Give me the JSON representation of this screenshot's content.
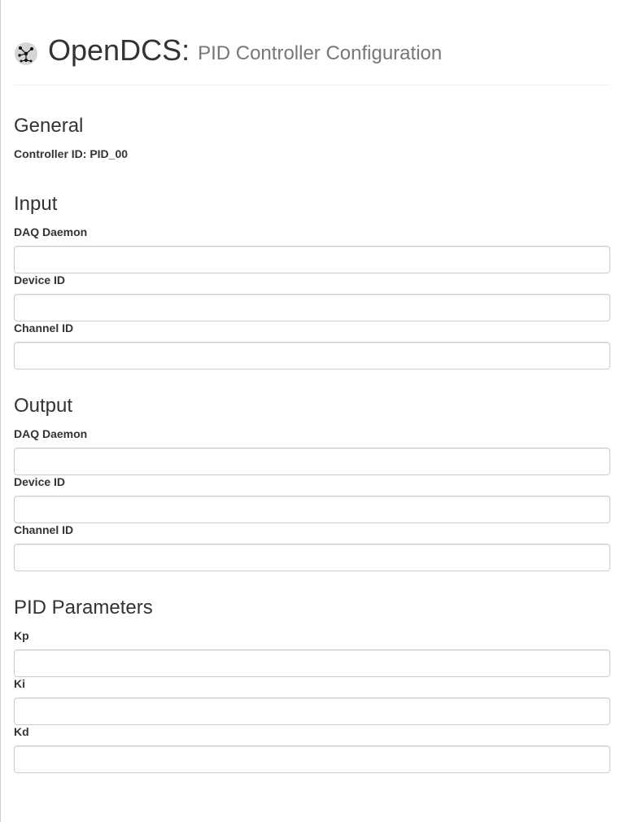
{
  "header": {
    "title": "OpenDCS:",
    "subtitle": "PID Controller Configuration",
    "logo_icon": "network-node-icon"
  },
  "general": {
    "heading": "General",
    "controller_id_text": "Controller ID: PID_00"
  },
  "input": {
    "heading": "Input",
    "daq_daemon_label": "DAQ Daemon",
    "daq_daemon_value": "",
    "device_id_label": "Device ID",
    "device_id_value": "",
    "channel_id_label": "Channel ID",
    "channel_id_value": ""
  },
  "output": {
    "heading": "Output",
    "daq_daemon_label": "DAQ Daemon",
    "daq_daemon_value": "",
    "device_id_label": "Device ID",
    "device_id_value": "",
    "channel_id_label": "Channel ID",
    "channel_id_value": ""
  },
  "pid": {
    "heading": "PID Parameters",
    "kp_label": "Kp",
    "kp_value": "",
    "ki_label": "Ki",
    "ki_value": "",
    "kd_label": "Kd",
    "kd_value": ""
  },
  "colors": {
    "text": "#333333",
    "subtitle": "#777777",
    "input_border": "#cccccc",
    "divider": "#eeeeee"
  }
}
